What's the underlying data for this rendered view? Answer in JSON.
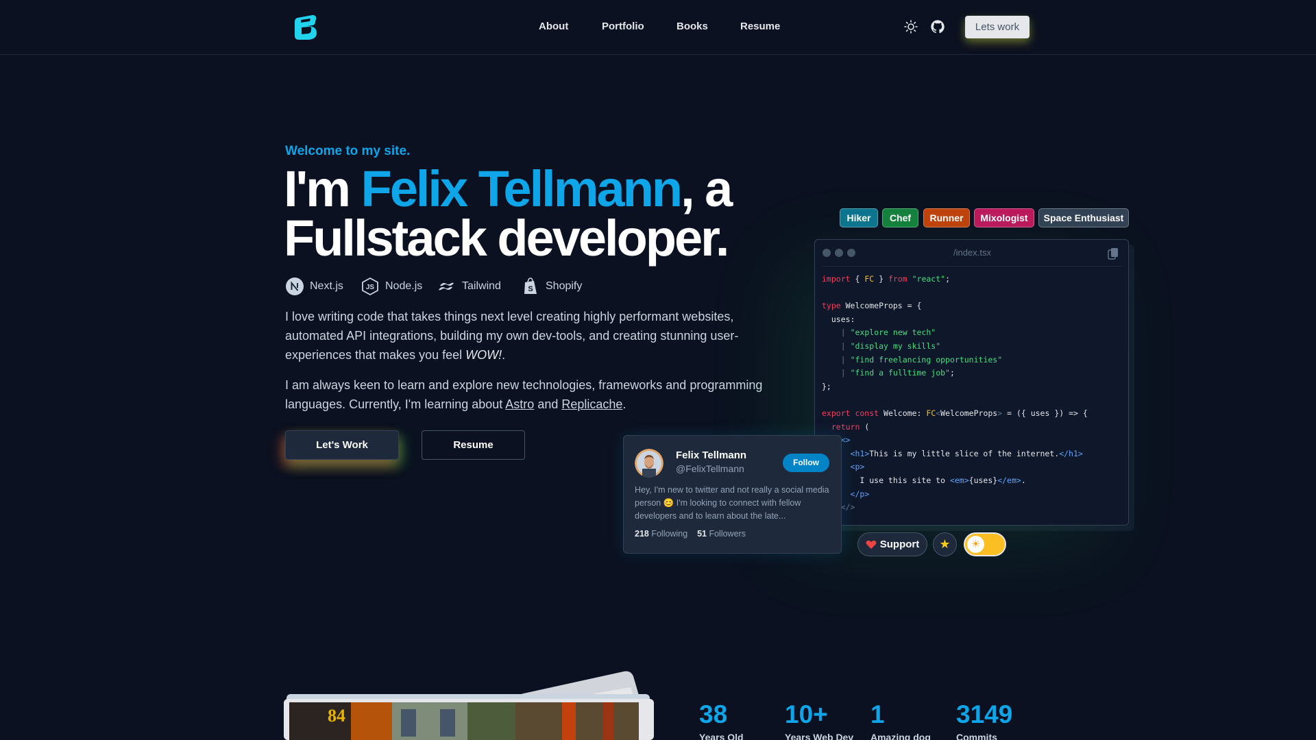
{
  "nav": {
    "links": [
      "About",
      "Portfolio",
      "Books",
      "Resume"
    ],
    "cta_label": "Lets work",
    "icons": [
      "logo-icon",
      "sun-icon",
      "github-icon"
    ]
  },
  "hero": {
    "welcome": "Welcome to my site.",
    "headline_prefix": "I'm ",
    "headline_name": "Felix Tellmann",
    "headline_suffix_line1": ", a",
    "headline_line2": "Fullstack developer.",
    "tech": [
      "Next.js",
      "Node.js",
      "Tailwind",
      "Shopify"
    ],
    "para1_text": "I love writing code that takes things next level creating highly performant websites, automated API integrations, building my own dev-tools, and creating stunning user-experiences that makes you feel ",
    "para1_em": "WOW!",
    "para1_end": ".",
    "para2_text": "I am always keen to learn and explore new technologies, frameworks and programming languages. Currently, I'm learning about ",
    "para2_link1": "Astro",
    "para2_and": " and ",
    "para2_link2": "Replicache",
    "para2_end": ".",
    "primary_button": "Let's Work",
    "secondary_button": "Resume"
  },
  "tags": [
    {
      "label": "Hiker",
      "color": "#0e7490"
    },
    {
      "label": "Chef",
      "color": "#15803d"
    },
    {
      "label": "Runner",
      "color": "#c2410c"
    },
    {
      "label": "Mixologist",
      "color": "#be185d"
    },
    {
      "label": "Space Enthusiast",
      "color": "#334155"
    }
  ],
  "code_card": {
    "filename": "/index.tsx"
  },
  "twitter": {
    "name": "Felix Tellmann",
    "handle": "@FelixTellmann",
    "follow_label": "Follow",
    "bio": "Hey, I'm new to twitter and not really a social media person 😊 I'm looking to connect with fellow developers and to learn about the late...",
    "following_count": "218",
    "following_label": "Following",
    "followers_count": "51",
    "followers_label": "Followers"
  },
  "actions": {
    "support_label": "Support",
    "star_icon": "★",
    "toggle_icon": "☀"
  },
  "stats": [
    {
      "value": "38",
      "label": "Years Old"
    },
    {
      "value": "10+",
      "label": "Years Web Dev"
    },
    {
      "value": "1",
      "label": "Amazing dog"
    },
    {
      "value": "3149",
      "label": "Commits"
    }
  ],
  "photo_number": "84",
  "colors": {
    "background": "#0b1120",
    "accent": "#0ea5e9"
  }
}
